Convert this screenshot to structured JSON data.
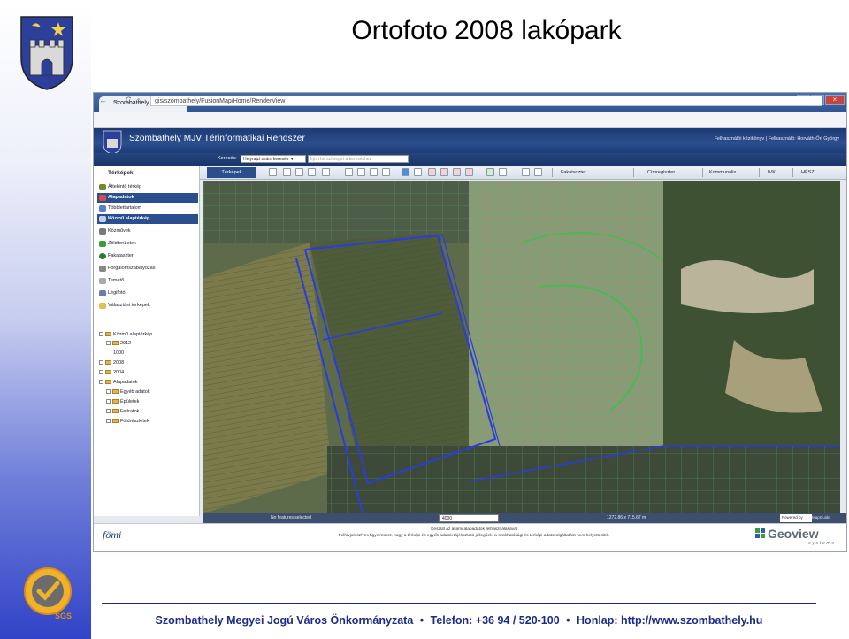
{
  "slide": {
    "title": "Ortofoto 2008 lakópark",
    "footer": {
      "org": "Szombathely Megyei Jogú Város Önkormányzata",
      "phone": "Telefon: +36 94 / 520-100",
      "web": "Honlap: http://www.szombathely.hu",
      "separator": "•"
    }
  },
  "browser": {
    "tab_title": "Szombathely",
    "tab_close": "×",
    "url": "gis/szombathely/FusionMap/Home/RenderView",
    "nav": {
      "back": "←",
      "forward": "→",
      "reload": "C",
      "home": "⌂"
    },
    "win": {
      "min": "–",
      "max": "□",
      "close": "×"
    }
  },
  "app": {
    "title": "Szombathely MJV Térinformatikai Rendszer",
    "user_line": "Felhasználói kézikönyv | Felhasználó: Horváth-Őri György",
    "search": {
      "label": "Keresés:",
      "mode": "Helyrajzi szám keresés ▼",
      "placeholder": "Írjon be szöveget a kereséshez"
    },
    "toolbar": {
      "active_tab": "Térképek",
      "tabs": [
        "Fakataszter",
        "Címregiszter",
        "Kommunális",
        "IVK",
        "HÉSZ"
      ]
    },
    "sidebar": {
      "header": "Térképek",
      "items": [
        {
          "label": "Áttekintő térkép",
          "active": false
        },
        {
          "label": "Alapadatok",
          "active": true
        },
        {
          "label": "Többlettartalom",
          "active": false
        },
        {
          "label": "Közmű alaptérkép",
          "active": true
        },
        {
          "label": "Közművek",
          "active": false
        },
        {
          "label": "Zöldterületek",
          "active": false
        },
        {
          "label": "Fakataszter",
          "active": false
        },
        {
          "label": "Forgalomszabályozás",
          "active": false
        },
        {
          "label": "Temető",
          "active": false
        },
        {
          "label": "Légifotó",
          "active": false
        },
        {
          "label": "Választási térképek",
          "active": false
        }
      ],
      "tree": [
        {
          "label": "Közmű alaptérkép",
          "level": 0
        },
        {
          "label": "2012",
          "level": 1
        },
        {
          "label": "1000",
          "level": 2
        },
        {
          "label": "2008",
          "level": 1
        },
        {
          "label": "2004",
          "level": 1
        },
        {
          "label": "Alapadatok",
          "level": 0
        },
        {
          "label": "Egyéb adatok",
          "level": 1
        },
        {
          "label": "Épületek",
          "level": 1
        },
        {
          "label": "Felíratok",
          "level": 1
        },
        {
          "label": "Földrészletek",
          "level": 1
        }
      ]
    },
    "status": {
      "selection": "No features selected",
      "scale": "4000",
      "dimensions": "1272.86 x 715.67 m",
      "powered": "Powered by",
      "mapguide": "MapGuide"
    },
    "footer": {
      "fomi": "fömi",
      "notice_1": "Készült az állami alapadatok felhasználásával",
      "notice_2": "Felhívjuk szíves figyelmüket, hogy a térképi és egyéb adatok tájékoztató jellegűek, a szakhatósági és térképi adatszolgáltatást nem helyettesítik.",
      "geoview": "Geoview",
      "geoview_sub": "systems"
    }
  },
  "colors": {
    "brand_blue": "#1d2c86",
    "app_header": "#1d3b74",
    "parcel_blue": "#2a3be0",
    "parcel_green": "#37c24a"
  }
}
